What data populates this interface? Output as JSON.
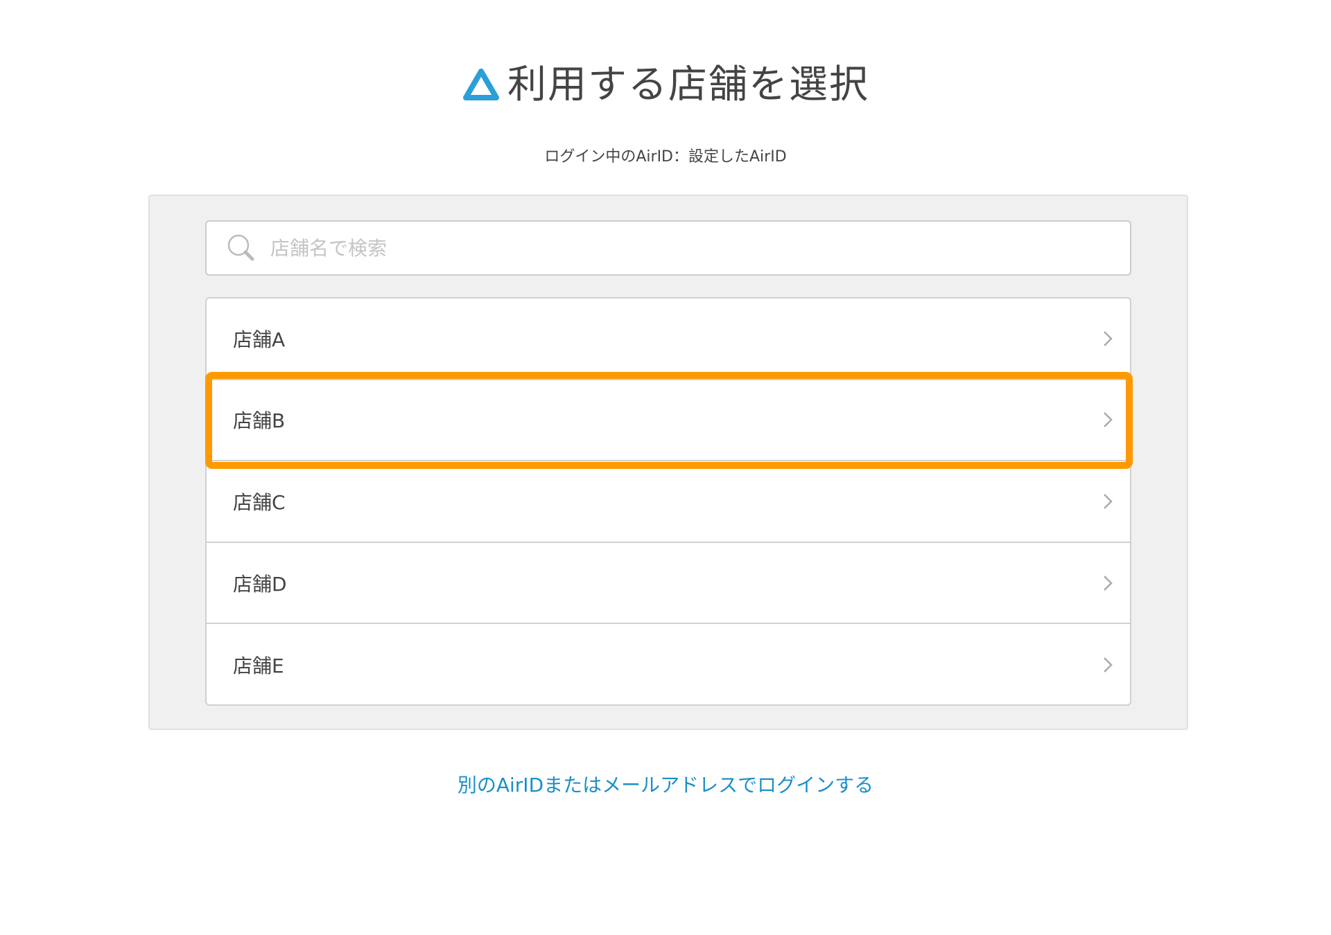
{
  "header": {
    "title": "利用する店舗を選択",
    "logo_icon": "airid-triangle-logo",
    "logo_color": "#2a9fd8"
  },
  "login_info": "ログイン中のAirID：設定したAirID",
  "search": {
    "placeholder": "店舗名で検索",
    "value": "",
    "icon": "search-icon"
  },
  "stores": [
    {
      "label": "店舗A"
    },
    {
      "label": "店舗B"
    },
    {
      "label": "店舗C"
    },
    {
      "label": "店舗D"
    },
    {
      "label": "店舗E"
    }
  ],
  "highlight": {
    "target": "店舗B",
    "color": "#ff9900"
  },
  "alt_login_link": "別のAirIDまたはメールアドレスでログインする",
  "colors": {
    "link": "#1a8fc9",
    "panel_bg": "#f0f0f0"
  }
}
